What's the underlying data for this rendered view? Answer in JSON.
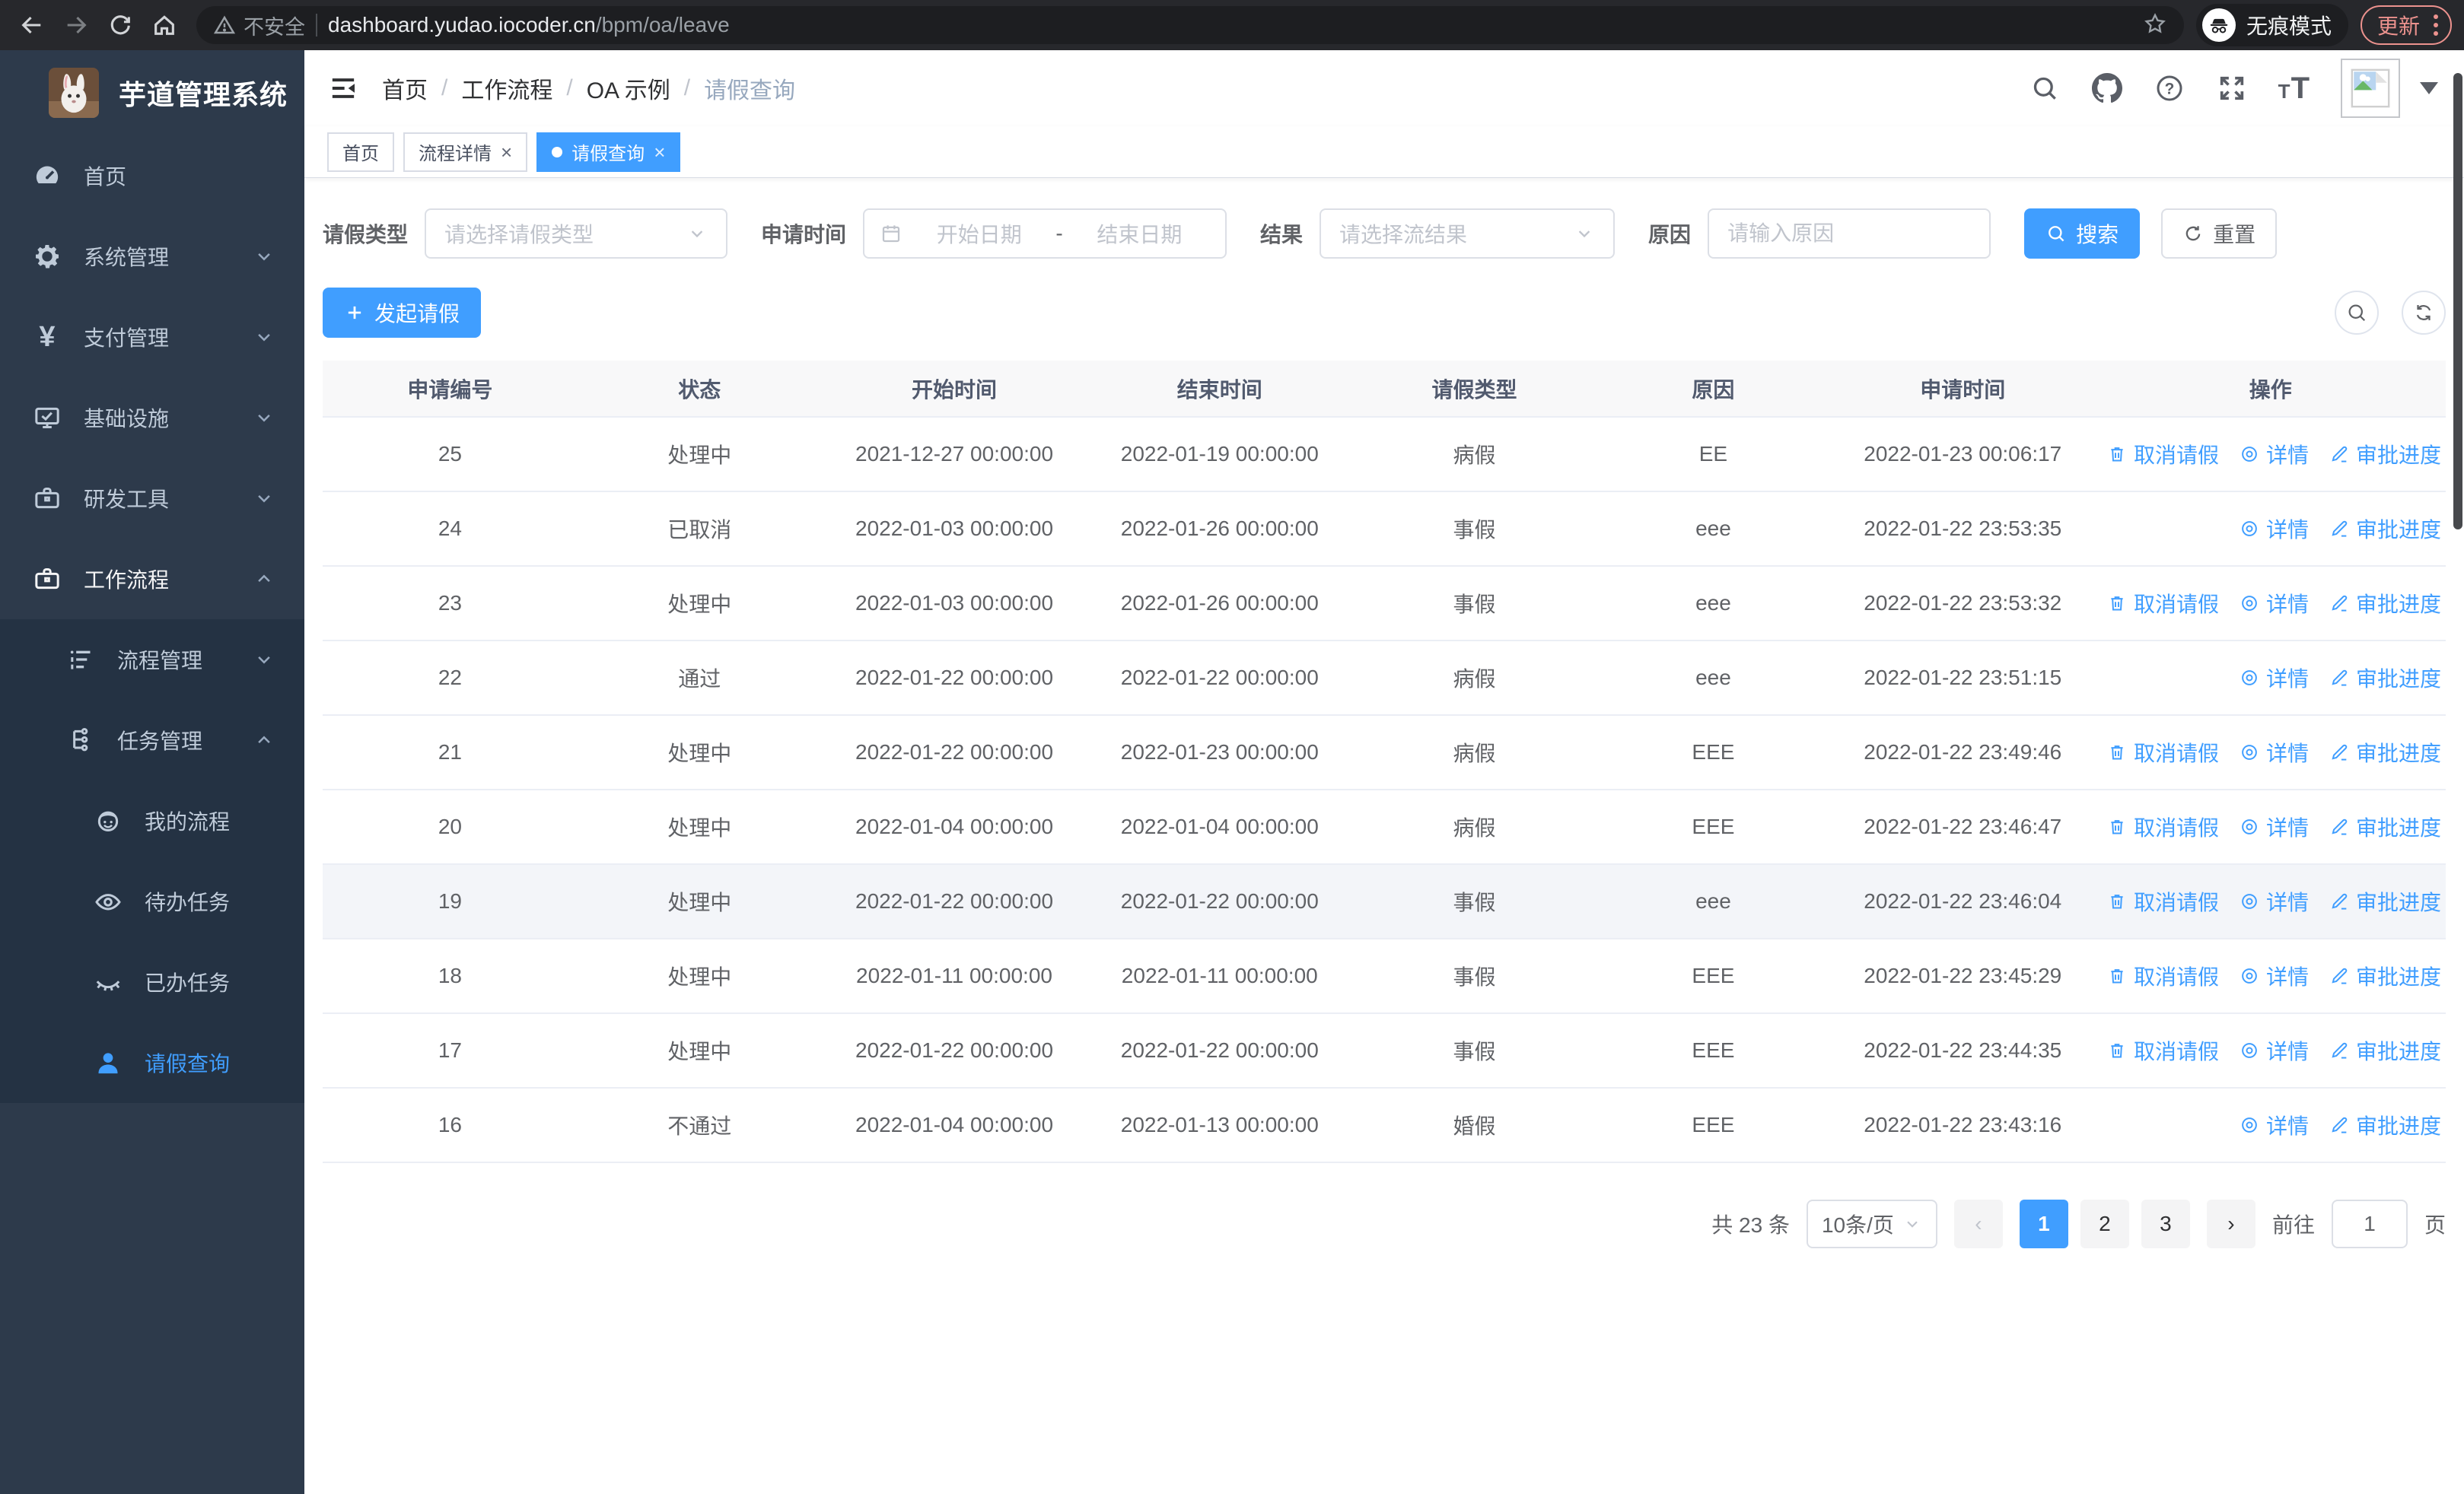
{
  "browser": {
    "security_label": "不安全",
    "url_host": "dashboard.yudao.iocoder.cn",
    "url_path": "/bpm/oa/leave",
    "incognito_label": "无痕模式",
    "update_label": "更新"
  },
  "colors": {
    "accent": "#409eff",
    "sidebar_bg": "#2d3a4b",
    "sidebar_submenu_bg": "#243243",
    "sidebar_text": "#bfcbd9",
    "update_chip": "#ec928e"
  },
  "sidebar": {
    "title": "芋道管理系统",
    "items": [
      {
        "id": "home",
        "label": "首页",
        "icon": "dashboard-icon",
        "level": 0
      },
      {
        "id": "system",
        "label": "系统管理",
        "icon": "gear-icon",
        "level": 0,
        "chevron": "down"
      },
      {
        "id": "payment",
        "label": "支付管理",
        "icon": "yen-icon",
        "level": 0,
        "chevron": "down"
      },
      {
        "id": "infra",
        "label": "基础设施",
        "icon": "monitor-icon",
        "level": 0,
        "chevron": "down"
      },
      {
        "id": "devtools",
        "label": "研发工具",
        "icon": "briefcase-icon",
        "level": 0,
        "chevron": "down"
      },
      {
        "id": "workflow",
        "label": "工作流程",
        "icon": "briefcase-icon",
        "level": 0,
        "chevron": "up",
        "open": true
      },
      {
        "id": "process-mgmt",
        "label": "流程管理",
        "icon": "list-icon",
        "level": 1,
        "chevron": "down",
        "dark": true
      },
      {
        "id": "task-mgmt",
        "label": "任务管理",
        "icon": "tree-icon",
        "level": 1,
        "chevron": "up",
        "dark": true
      },
      {
        "id": "my-process",
        "label": "我的流程",
        "icon": "face-icon",
        "level": 2,
        "dark": true
      },
      {
        "id": "todo-task",
        "label": "待办任务",
        "icon": "eye-icon",
        "level": 2,
        "dark": true
      },
      {
        "id": "done-task",
        "label": "已办任务",
        "icon": "eye-closed-icon",
        "level": 2,
        "dark": true
      },
      {
        "id": "leave-query",
        "label": "请假查询",
        "icon": "user-icon",
        "level": 2,
        "dark": true,
        "active": true
      }
    ]
  },
  "header": {
    "breadcrumb": [
      "首页",
      "工作流程",
      "OA 示例",
      "请假查询"
    ],
    "tabs": [
      {
        "id": "home",
        "label": "首页",
        "closable": false,
        "active": false
      },
      {
        "id": "process-detail",
        "label": "流程详情",
        "closable": true,
        "active": false
      },
      {
        "id": "leave-query",
        "label": "请假查询",
        "closable": true,
        "active": true
      }
    ]
  },
  "filters": {
    "leave_type_label": "请假类型",
    "leave_type_placeholder": "请选择请假类型",
    "apply_time_label": "申请时间",
    "start_date_placeholder": "开始日期",
    "range_separator": "-",
    "end_date_placeholder": "结束日期",
    "result_label": "结果",
    "result_placeholder": "请选择流结果",
    "reason_label": "原因",
    "reason_placeholder": "请输入原因",
    "search_label": "搜索",
    "reset_label": "重置"
  },
  "toolbar": {
    "create_label": "发起请假"
  },
  "table": {
    "columns": [
      "申请编号",
      "状态",
      "开始时间",
      "结束时间",
      "请假类型",
      "原因",
      "申请时间",
      "操作"
    ],
    "action_labels": {
      "cancel": "取消请假",
      "detail": "详情",
      "progress": "审批进度"
    },
    "rows": [
      {
        "id": "25",
        "status": "处理中",
        "start": "2021-12-27 00:00:00",
        "end": "2022-01-19 00:00:00",
        "type": "病假",
        "reason": "EE",
        "apply": "2022-01-23 00:06:17",
        "actions": [
          "cancel",
          "detail",
          "progress"
        ],
        "highlight": false
      },
      {
        "id": "24",
        "status": "已取消",
        "start": "2022-01-03 00:00:00",
        "end": "2022-01-26 00:00:00",
        "type": "事假",
        "reason": "eee",
        "apply": "2022-01-22 23:53:35",
        "actions": [
          "detail",
          "progress"
        ],
        "highlight": false
      },
      {
        "id": "23",
        "status": "处理中",
        "start": "2022-01-03 00:00:00",
        "end": "2022-01-26 00:00:00",
        "type": "事假",
        "reason": "eee",
        "apply": "2022-01-22 23:53:32",
        "actions": [
          "cancel",
          "detail",
          "progress"
        ],
        "highlight": false
      },
      {
        "id": "22",
        "status": "通过",
        "start": "2022-01-22 00:00:00",
        "end": "2022-01-22 00:00:00",
        "type": "病假",
        "reason": "eee",
        "apply": "2022-01-22 23:51:15",
        "actions": [
          "detail",
          "progress"
        ],
        "highlight": false
      },
      {
        "id": "21",
        "status": "处理中",
        "start": "2022-01-22 00:00:00",
        "end": "2022-01-23 00:00:00",
        "type": "病假",
        "reason": "EEE",
        "apply": "2022-01-22 23:49:46",
        "actions": [
          "cancel",
          "detail",
          "progress"
        ],
        "highlight": false
      },
      {
        "id": "20",
        "status": "处理中",
        "start": "2022-01-04 00:00:00",
        "end": "2022-01-04 00:00:00",
        "type": "病假",
        "reason": "EEE",
        "apply": "2022-01-22 23:46:47",
        "actions": [
          "cancel",
          "detail",
          "progress"
        ],
        "highlight": false
      },
      {
        "id": "19",
        "status": "处理中",
        "start": "2022-01-22 00:00:00",
        "end": "2022-01-22 00:00:00",
        "type": "事假",
        "reason": "eee",
        "apply": "2022-01-22 23:46:04",
        "actions": [
          "cancel",
          "detail",
          "progress"
        ],
        "highlight": true
      },
      {
        "id": "18",
        "status": "处理中",
        "start": "2022-01-11 00:00:00",
        "end": "2022-01-11 00:00:00",
        "type": "事假",
        "reason": "EEE",
        "apply": "2022-01-22 23:45:29",
        "actions": [
          "cancel",
          "detail",
          "progress"
        ],
        "highlight": false
      },
      {
        "id": "17",
        "status": "处理中",
        "start": "2022-01-22 00:00:00",
        "end": "2022-01-22 00:00:00",
        "type": "事假",
        "reason": "EEE",
        "apply": "2022-01-22 23:44:35",
        "actions": [
          "cancel",
          "detail",
          "progress"
        ],
        "highlight": false
      },
      {
        "id": "16",
        "status": "不通过",
        "start": "2022-01-04 00:00:00",
        "end": "2022-01-13 00:00:00",
        "type": "婚假",
        "reason": "EEE",
        "apply": "2022-01-22 23:43:16",
        "actions": [
          "detail",
          "progress"
        ],
        "highlight": false
      }
    ]
  },
  "pagination": {
    "total_label": "共 23 条",
    "page_size": "10条/页",
    "pages": [
      "1",
      "2",
      "3"
    ],
    "active_page": "1",
    "goto_label": "前往",
    "goto_value": "1",
    "page_unit": "页"
  }
}
